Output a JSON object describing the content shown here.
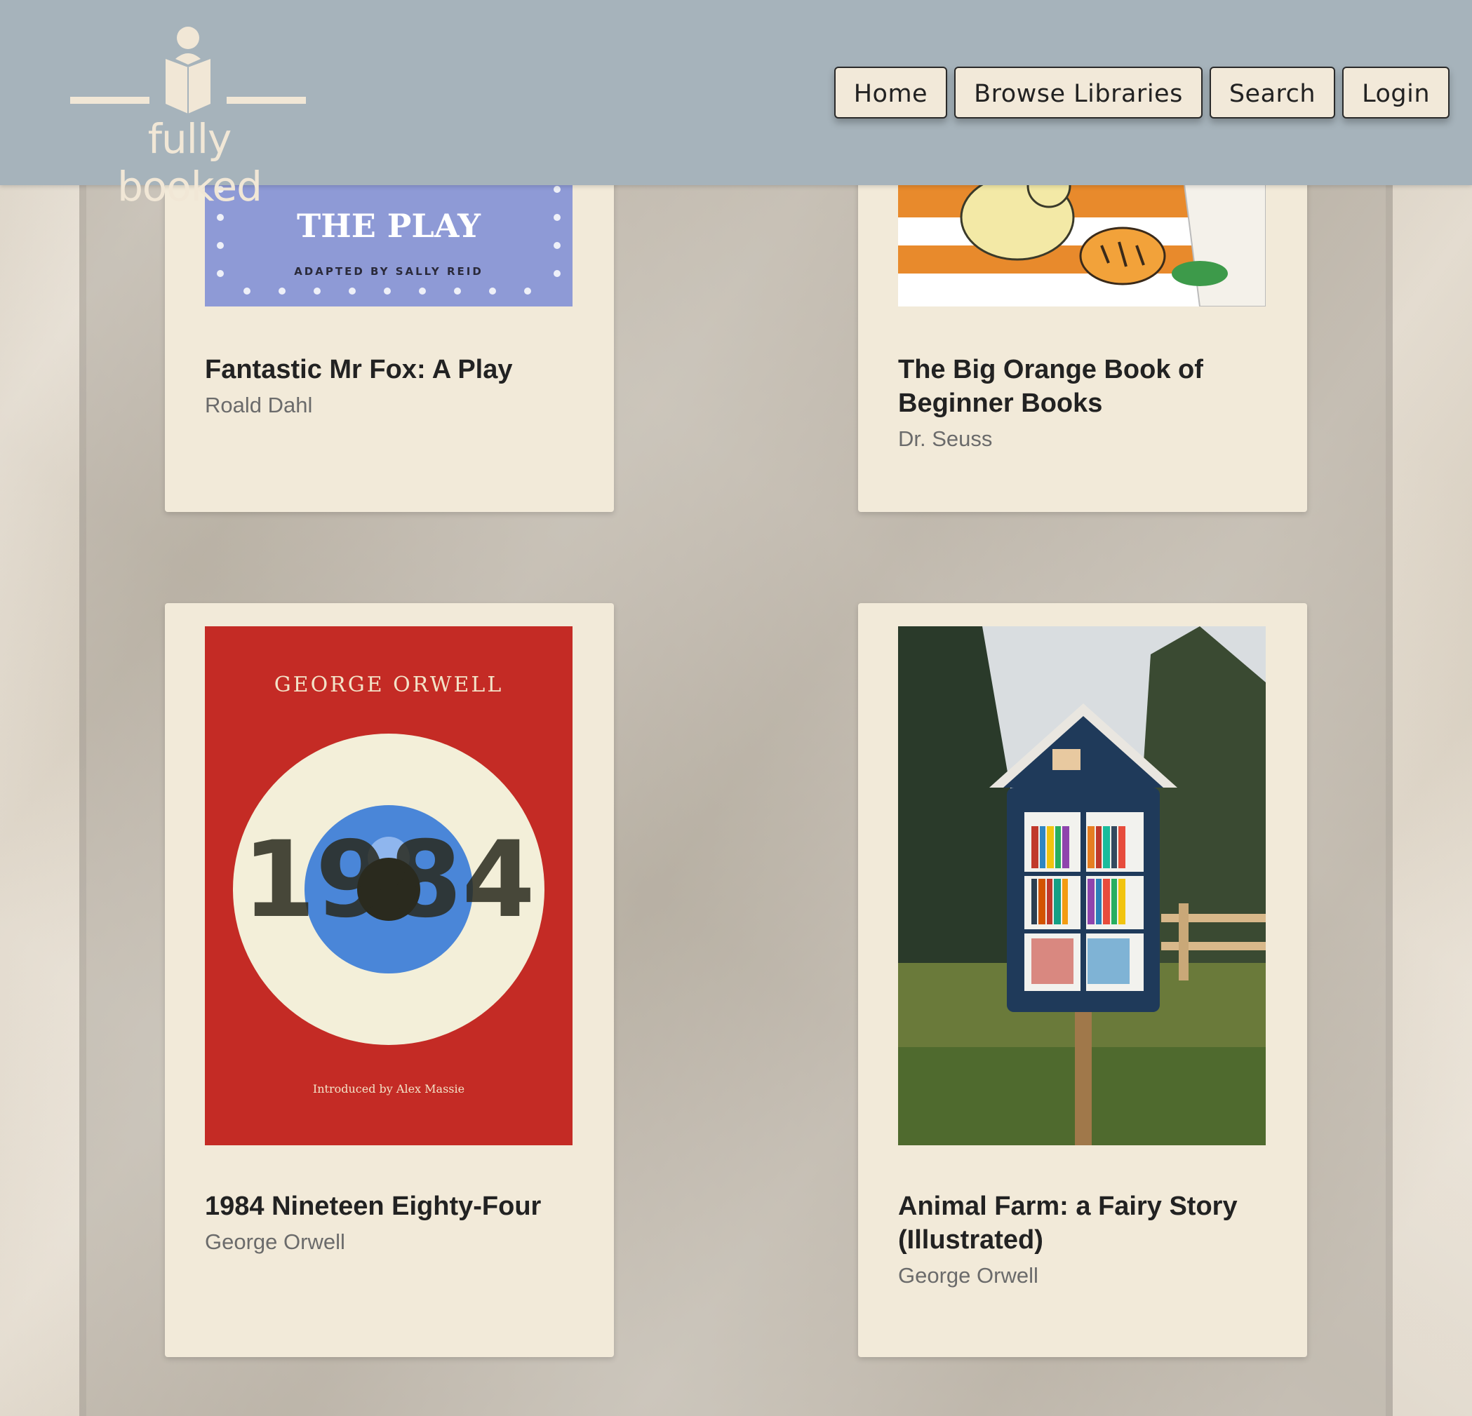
{
  "header": {
    "logo_text": "fully booked",
    "nav": [
      "Home",
      "Browse Libraries",
      "Search",
      "Login"
    ]
  },
  "books": [
    {
      "title": "Fantastic Mr Fox: A Play",
      "author": "Roald Dahl",
      "cover_title": "THE PLAY",
      "cover_subtitle": "ADAPTED BY SALLY REID",
      "cover_color": "#8e9ad6"
    },
    {
      "title": "The Big Orange Book of Beginner Books",
      "author": "Dr. Seuss",
      "cover_color": "#e88a2c"
    },
    {
      "title": "1984 Nineteen Eighty-Four",
      "author": "George Orwell",
      "cover_author": "GEORGE ORWELL",
      "cover_number": "1984",
      "cover_intro": "Introduced by Alex Massie",
      "cover_color": "#c42b25"
    },
    {
      "title": "Animal Farm: a Fairy Story (Illustrated)",
      "author": "George Orwell"
    }
  ],
  "colors": {
    "header": "#a6b3bb",
    "card": "#f2ead9",
    "logo": "#f1e7d6"
  }
}
